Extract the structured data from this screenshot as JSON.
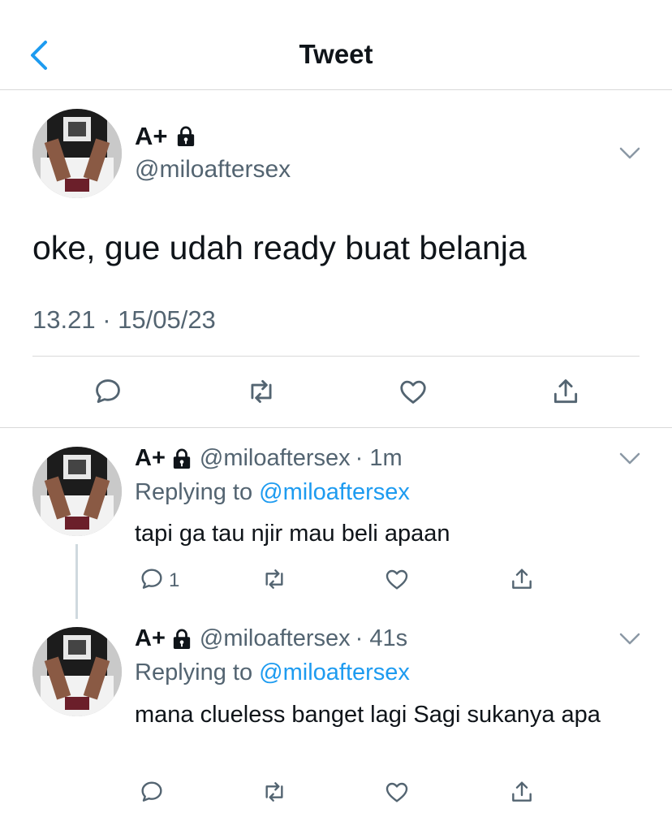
{
  "header": {
    "title": "Tweet",
    "back_icon": "chevron-left-icon"
  },
  "colors": {
    "accent": "#1d9bf0",
    "secondary_text": "#536471",
    "divider": "#d9d9d9"
  },
  "main_tweet": {
    "author_name": "A+",
    "lock_icon": "lock-icon",
    "handle": "@miloaftersex",
    "text": "oke, gue udah ready buat belanja",
    "timestamp": "13.21 · 15/05/23",
    "actions": [
      "reply-icon",
      "retweet-icon",
      "like-icon",
      "share-icon"
    ]
  },
  "replies": [
    {
      "author_name": "A+",
      "handle": "@miloaftersex",
      "time": "· 1m",
      "replying_prefix": "Replying to",
      "replying_to": "@miloaftersex",
      "text": "tapi ga tau njir mau beli apaan",
      "reply_count": "1"
    },
    {
      "author_name": "A+",
      "handle": "@miloaftersex",
      "time": "· 41s",
      "replying_prefix": "Replying to",
      "replying_to": "@miloaftersex",
      "text": "mana clueless banget lagi Sagi sukanya apa"
    }
  ]
}
